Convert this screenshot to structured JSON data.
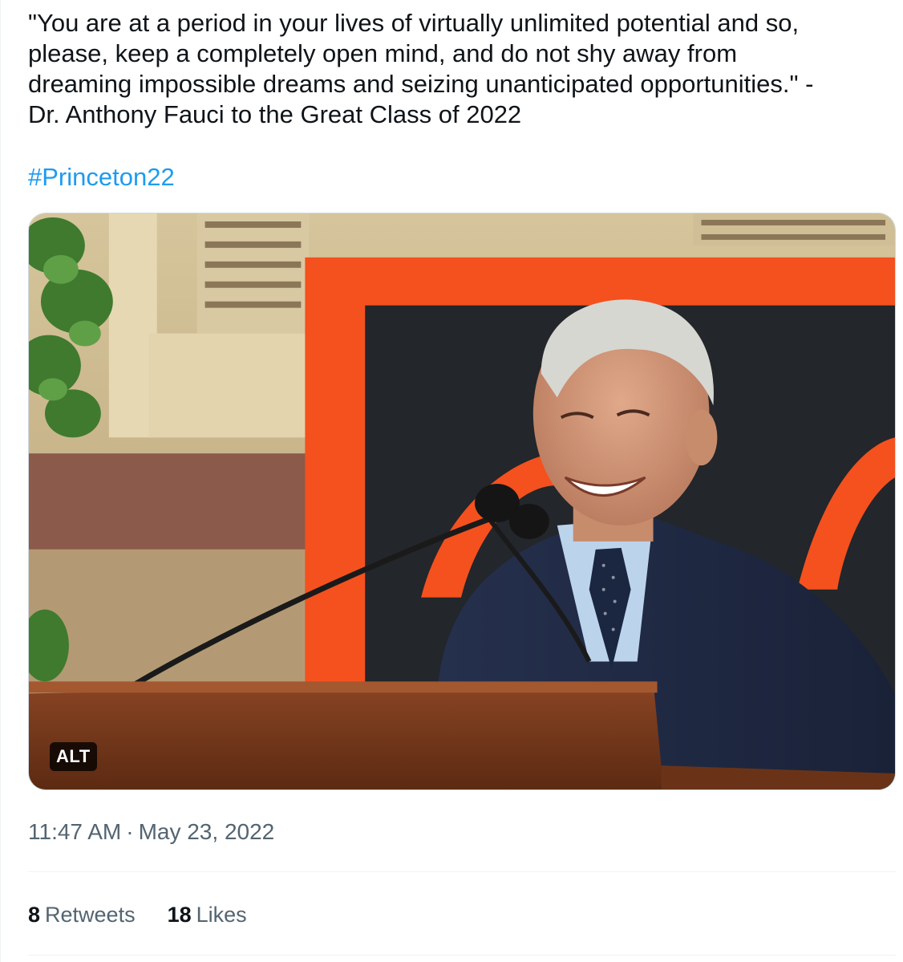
{
  "tweet": {
    "text": "\"You are at a period in your lives of virtually unlimited potential and so,\nplease, keep a completely open mind, and do not shy away from\ndreaming impossible dreams and seizing unanticipated opportunities.\" -\nDr. Anthony Fauci to the Great Class of 2022",
    "hashtag": "#Princeton22",
    "media": {
      "alt_badge": "ALT",
      "colors": {
        "banner_orange": "#f4511e",
        "banner_black": "#23262a",
        "wall_tan": "#c9b48a",
        "suit_navy": "#1f2a44",
        "podium_wood": "#7a3b1c"
      }
    },
    "time": "11:47 AM",
    "separator": "·",
    "date": "May 23, 2022",
    "stats": {
      "retweets_count": "8",
      "retweets_label": "Retweets",
      "likes_count": "18",
      "likes_label": "Likes"
    }
  },
  "colors": {
    "text": "#0f1419",
    "secondary": "#536471",
    "link": "#1d9bf0",
    "divider": "#eff3f4"
  }
}
